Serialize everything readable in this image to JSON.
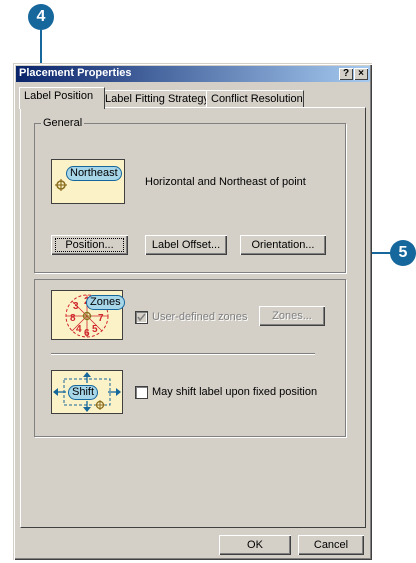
{
  "callouts": {
    "first": "4",
    "second": "5"
  },
  "dialog": {
    "title": "Placement Properties",
    "help_btn": "?",
    "close_btn": "×",
    "tabs": [
      {
        "label": "Label Position"
      },
      {
        "label": "Label Fitting Strategy"
      },
      {
        "label": "Conflict Resolution"
      }
    ],
    "general": {
      "group_label": "General",
      "preview_label": "Northeast",
      "description": "Horizontal and Northeast of point",
      "position_btn": "Position...",
      "label_offset_btn": "Label Offset...",
      "orientation_btn": "Orientation..."
    },
    "zones": {
      "preview_label": "Zones",
      "zone_numbers": [
        "3",
        "2",
        "1",
        "8",
        "7",
        "4",
        "5",
        "6"
      ],
      "user_defined_checkbox": "User-defined zones",
      "zones_btn": "Zones..."
    },
    "shift": {
      "preview_label": "Shift",
      "checkbox_label": "May shift label upon fixed position"
    },
    "ok_btn": "OK",
    "cancel_btn": "Cancel"
  },
  "colors": {
    "callout": "#16679c",
    "preview_bg": "#fcf2c8",
    "pill": "#a7d6e9",
    "zone_numbers": "#d0262c"
  }
}
